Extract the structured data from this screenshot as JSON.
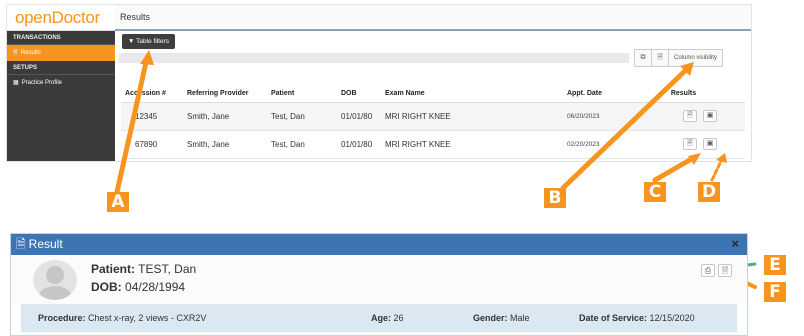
{
  "app": {
    "logo": "openDoctor",
    "page_title": "Results"
  },
  "sidebar": {
    "sections": [
      {
        "heading": "TRANSACTIONS",
        "items": [
          {
            "label": "Results",
            "active": true
          }
        ]
      },
      {
        "heading": "SETUPS",
        "items": [
          {
            "label": "Practice Profile",
            "active": false
          }
        ]
      }
    ]
  },
  "toolbar": {
    "filters_label": "Table filters",
    "column_visibility_label": "Column visibility"
  },
  "table": {
    "columns": [
      "Accession #",
      "Referring Provider",
      "Patient",
      "DOB",
      "Exam Name",
      "Appt. Date",
      "Results"
    ],
    "rows": [
      {
        "accession": "12345",
        "provider": "Smith, Jane",
        "patient": "Test, Dan",
        "dob": "01/01/80",
        "exam": "MRI RIGHT KNEE",
        "appt": "06/20/2023"
      },
      {
        "accession": "67890",
        "provider": "Smith, Jane",
        "patient": "Test, Dan",
        "dob": "01/01/80",
        "exam": "MRI RIGHT KNEE",
        "appt": "02/20/2023"
      }
    ]
  },
  "callouts": [
    "A",
    "B",
    "C",
    "D",
    "E",
    "F"
  ],
  "colors": {
    "accent_orange": "#f7941d",
    "sidebar_dark": "#3b3b3b",
    "modal_header_blue": "#3d74b4",
    "info_row_blue": "#dbe7f1",
    "callout_green": "#5aa88a"
  },
  "modal": {
    "title": "Result",
    "close_glyph": "×",
    "patient_label": "Patient:",
    "patient_name": "TEST, Dan",
    "dob_label": "DOB:",
    "dob": "04/28/1994",
    "procedure_label": "Procedure:",
    "procedure": "Chest x-ray, 2 views - CXR2V",
    "age_label": "Age:",
    "age": "26",
    "gender_label": "Gender:",
    "gender": "Male",
    "dos_label": "Date of Service:",
    "dos": "12/15/2020"
  },
  "icons": {
    "filter": "funnel-icon",
    "copy": "copy-icon",
    "csv": "document-icon",
    "report": "report-icon",
    "image": "image-icon",
    "print": "print-icon",
    "pdf": "pdf-icon",
    "close": "close-icon"
  }
}
